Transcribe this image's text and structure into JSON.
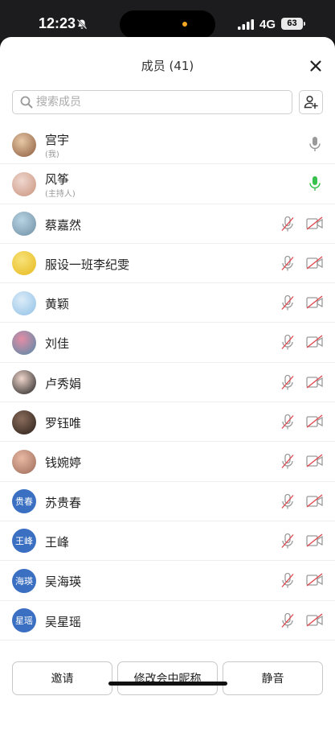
{
  "status_bar": {
    "time": "12:23",
    "network": "4G",
    "battery": "63"
  },
  "header": {
    "title": "成员 (41)"
  },
  "search": {
    "placeholder": "搜索成员",
    "value": ""
  },
  "members": [
    {
      "name": "宫宇",
      "role": "(我)",
      "avatar": {
        "type": "photo",
        "colors": [
          "#e7c9a6",
          "#8b5a3c"
        ]
      },
      "mic": "off-gray"
    },
    {
      "name": "风筝",
      "role": "(主持人)",
      "avatar": {
        "type": "photo",
        "colors": [
          "#efd7cf",
          "#c9927c"
        ]
      },
      "mic": "on-green"
    },
    {
      "name": "蔡嘉然",
      "role": "",
      "avatar": {
        "type": "photo",
        "colors": [
          "#b8d4e4",
          "#6e8ea2"
        ]
      },
      "mic": "muted",
      "video": "off"
    },
    {
      "name": "服设一班李纪雯",
      "role": "",
      "avatar": {
        "type": "photo",
        "colors": [
          "#f7e27a",
          "#e7b91d"
        ]
      },
      "mic": "muted",
      "video": "off"
    },
    {
      "name": "黄颖",
      "role": "",
      "avatar": {
        "type": "photo",
        "colors": [
          "#dcecf8",
          "#8fc0e6"
        ]
      },
      "mic": "muted",
      "video": "off"
    },
    {
      "name": "刘佳",
      "role": "",
      "avatar": {
        "type": "photo",
        "colors": [
          "#e58da6",
          "#4f8aa8"
        ]
      },
      "mic": "muted",
      "video": "off"
    },
    {
      "name": "卢秀娟",
      "role": "",
      "avatar": {
        "type": "photo",
        "colors": [
          "#f0d6cc",
          "#1e1e1e"
        ]
      },
      "mic": "muted",
      "video": "off"
    },
    {
      "name": "罗钰唯",
      "role": "",
      "avatar": {
        "type": "photo",
        "colors": [
          "#8a6d5c",
          "#2a1e18"
        ]
      },
      "mic": "muted",
      "video": "off"
    },
    {
      "name": "钱婉婷",
      "role": "",
      "avatar": {
        "type": "photo",
        "colors": [
          "#e9b9a4",
          "#9c6a58"
        ]
      },
      "mic": "muted",
      "video": "off"
    },
    {
      "name": "苏贵春",
      "role": "",
      "avatar": {
        "type": "text",
        "text": "贵春",
        "color": "#3a6fc2"
      },
      "mic": "muted",
      "video": "off"
    },
    {
      "name": "王峰",
      "role": "",
      "avatar": {
        "type": "text",
        "text": "王峰",
        "color": "#3a6fc2"
      },
      "mic": "muted",
      "video": "off"
    },
    {
      "name": "吴海瑛",
      "role": "",
      "avatar": {
        "type": "text",
        "text": "海瑛",
        "color": "#3a6fc2"
      },
      "mic": "muted",
      "video": "off"
    },
    {
      "name": "吴星瑶",
      "role": "",
      "avatar": {
        "type": "text",
        "text": "星瑶",
        "color": "#3a6fc2"
      },
      "mic": "muted",
      "video": "off"
    },
    {
      "name": "",
      "role": "",
      "avatar": {
        "type": "text",
        "text": "",
        "color": "#3a6fc2"
      },
      "mic": "muted",
      "video": "off"
    }
  ],
  "footer": {
    "invite": "邀请",
    "rename": "修改会中昵称",
    "mute": "静音"
  },
  "colors": {
    "accent_blue": "#3a6fc2",
    "mic_green": "#36c24c",
    "muted_red": "#e0434a",
    "icon_gray": "#9a9a9a"
  }
}
